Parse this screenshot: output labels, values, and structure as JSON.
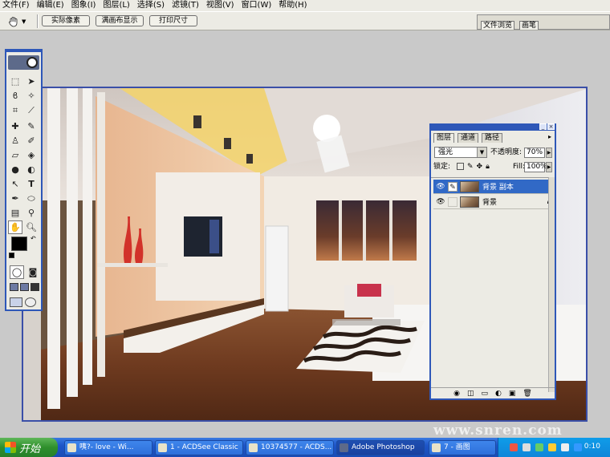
{
  "menu": {
    "items": [
      "文件(F)",
      "编辑(E)",
      "图象(I)",
      "图层(L)",
      "选择(S)",
      "滤镜(T)",
      "视图(V)",
      "窗口(W)",
      "帮助(H)"
    ]
  },
  "options_bar": {
    "tool_icon": "hand-tool-icon",
    "buttons": [
      "实际像素",
      "满画布显示",
      "打印尺寸"
    ],
    "palette_well_tabs": [
      "文件浏览",
      "画笔"
    ]
  },
  "toolbox": {
    "accent": "#2e57b8",
    "foreground_color": "#000000",
    "background_color": "#ffffff",
    "tools": [
      "marquee-tool-icon",
      "move-tool-icon",
      "lasso-tool-icon",
      "magic-wand-icon",
      "crop-tool-icon",
      "slice-tool-icon",
      "healing-brush-icon",
      "brush-tool-icon",
      "clone-stamp-icon",
      "history-brush-icon",
      "eraser-tool-icon",
      "paint-bucket-icon",
      "blur-tool-icon",
      "dodge-tool-icon",
      "path-select-icon",
      "type-tool-icon",
      "pen-tool-icon",
      "shape-tool-icon",
      "notes-tool-icon",
      "eyedropper-icon",
      "hand-tool-icon",
      "zoom-tool-icon"
    ]
  },
  "layers_panel": {
    "tabs": [
      "图层",
      "通道",
      "路径"
    ],
    "blend_mode": "强光",
    "opacity_label": "不透明度:",
    "opacity_value": "70%",
    "lock_label": "锁定:",
    "fill_label": "Fill:",
    "fill_value": "100%",
    "layers": [
      {
        "name": "背景 副本",
        "selected": true
      },
      {
        "name": "背景",
        "selected": false,
        "locked": true
      }
    ]
  },
  "taskbar": {
    "start_label": "开始",
    "tasks": [
      "咦?- love - Wi...",
      "1 - ACDSee Classic",
      "10374577 - ACDS...",
      "Adobe Photoshop",
      "7 - 画图"
    ],
    "active_task": 3,
    "clock": "0:10"
  },
  "watermark": "www.snren.com"
}
